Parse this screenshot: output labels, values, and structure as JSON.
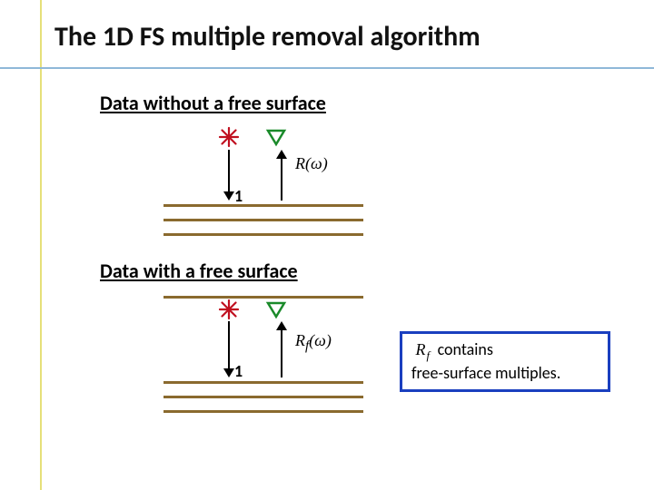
{
  "title": "The 1D FS multiple removal algorithm",
  "sections": {
    "without": "Data without a free surface",
    "with": "Data with a free surface"
  },
  "labels": {
    "one": "1",
    "R": "R(ω)",
    "Rf": "R",
    "Rf_sub": "f",
    "Rf_arg": "(ω)"
  },
  "callout": {
    "prefix_symbol": "R",
    "prefix_sub": "f",
    "line1_rest": "contains",
    "line2": "free-surface multiples."
  },
  "chart_data": {
    "type": "diagram",
    "diagrams": [
      {
        "name": "no-free-surface",
        "free_surface": false,
        "source": true,
        "receiver": true,
        "down_arrow_label": "1",
        "up_arrow_label": "R(ω)",
        "subsurface_layers": 3
      },
      {
        "name": "with-free-surface",
        "free_surface": true,
        "source": true,
        "receiver": true,
        "down_arrow_label": "1",
        "up_arrow_label": "R_f(ω)",
        "subsurface_layers": 3
      }
    ],
    "note": "R_f contains free-surface multiples"
  }
}
